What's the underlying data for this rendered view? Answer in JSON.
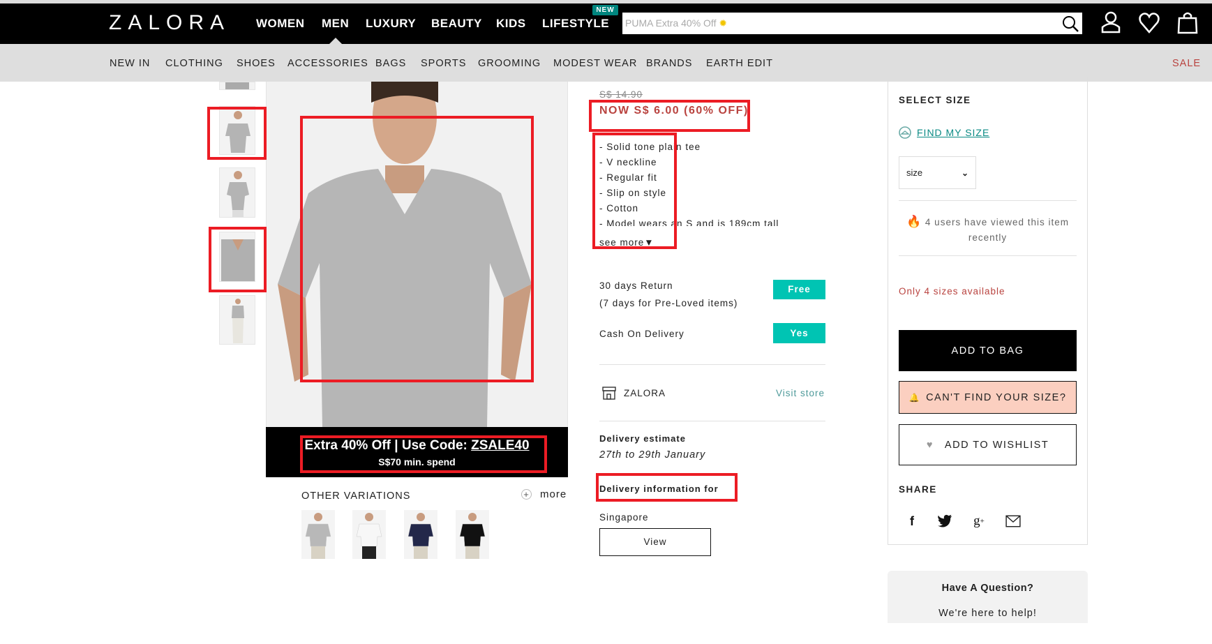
{
  "header": {
    "logo": "ZALORA",
    "nav": [
      "WOMEN",
      "MEN",
      "LUXURY",
      "BEAUTY",
      "KIDS",
      "LIFESTYLE"
    ],
    "new_badge": "NEW",
    "search_placeholder": "PUMA Extra 40% Off",
    "icons": [
      "search-icon",
      "account-icon",
      "heart-icon",
      "bag-icon"
    ]
  },
  "subnav": {
    "items": [
      "NEW IN",
      "CLOTHING",
      "SHOES",
      "ACCESSORIES",
      "BAGS",
      "SPORTS",
      "GROOMING",
      "MODEST WEAR",
      "BRANDS",
      "EARTH EDIT"
    ],
    "sale": "SALE"
  },
  "gallery": {
    "banner_line1": "Extra 40% Off | Use Code: ",
    "banner_code": "ZSALE40",
    "banner_line2": "S$70 min. spend",
    "other_variations": "OTHER VARIATIONS",
    "more": "more",
    "variation_colors": [
      "#b8b8b8",
      "#f7f7f7",
      "#23284a",
      "#111111"
    ]
  },
  "product": {
    "old_price": "S$ 14.90",
    "now_price": "NOW S$ 6.00 (60% OFF)",
    "bullets": [
      "- Solid tone plain tee",
      "- V neckline",
      "- Regular fit",
      "- Slip on style",
      "- Cotton",
      "- Model wears an S and is 189cm tall"
    ],
    "see_more": "see more",
    "return_label": "30 days Return",
    "return_note": "(7 days for Pre-Loved items)",
    "return_badge": "Free",
    "cod_label": "Cash On Delivery",
    "cod_badge": "Yes",
    "seller": "ZALORA",
    "visit_store": "Visit store",
    "delivery_estimate_label": "Delivery estimate",
    "delivery_estimate": "27th to 29th January",
    "delivery_info_label": "Delivery information for",
    "delivery_country": "Singapore",
    "view_button": "View"
  },
  "purchase": {
    "select_size": "SELECT SIZE",
    "find_my_size": "FIND MY SIZE",
    "size_select_value": "size",
    "viewed_text": "4 users have viewed this item recently",
    "only_sizes": "Only 4 sizes available",
    "add_to_bag": "ADD TO BAG",
    "cant_find_size": "CAN'T FIND YOUR SIZE?",
    "add_to_wishlist": "ADD TO WISHLIST",
    "share": "SHARE",
    "share_icons": [
      "facebook-icon",
      "twitter-icon",
      "google-plus-icon",
      "email-icon"
    ]
  },
  "help": {
    "title": "Have A Question?",
    "subtitle": "We're here to help!"
  },
  "colors": {
    "accent_red": "#b9433f",
    "teal": "#00c4b3",
    "find_size_teal": "#0a8a84",
    "annotation_red": "#ec1c24",
    "cant_find_bg": "#fbcfc0"
  }
}
